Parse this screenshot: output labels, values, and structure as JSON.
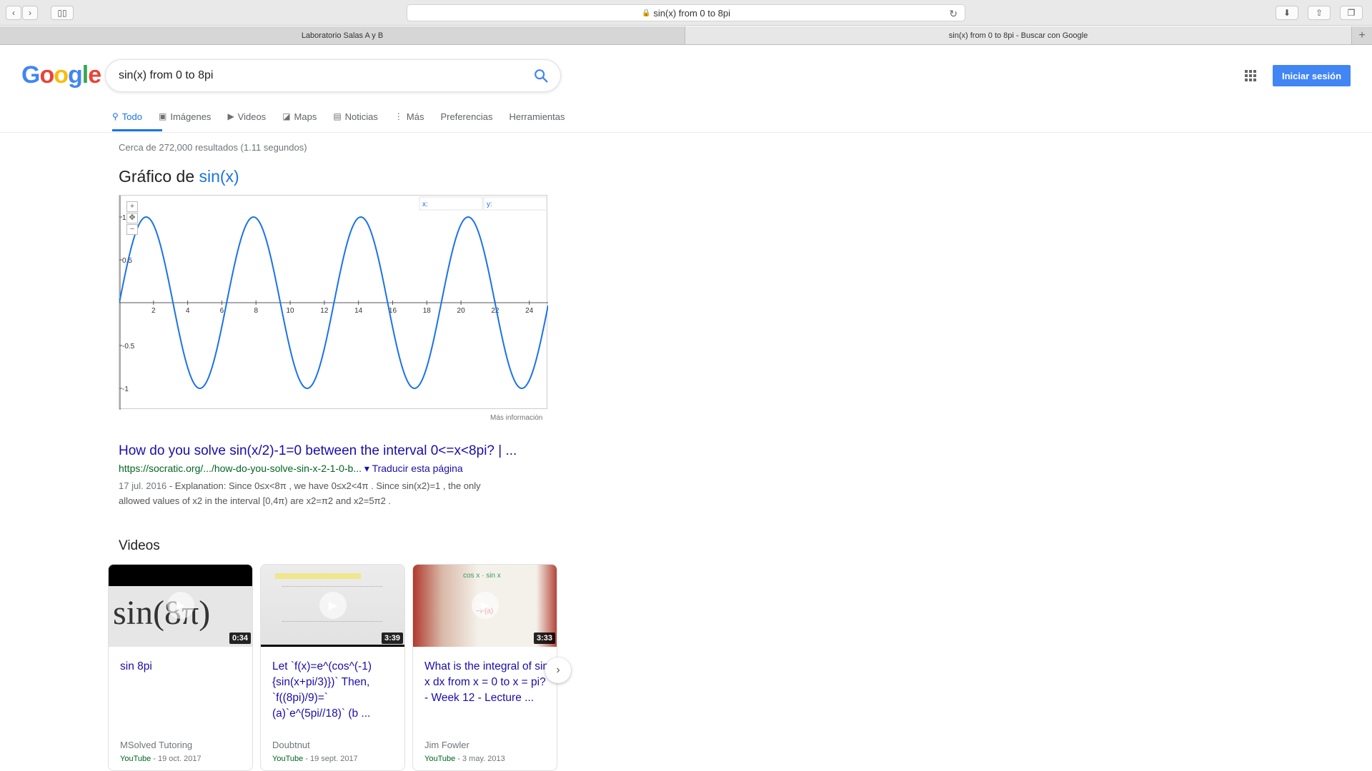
{
  "browser": {
    "url": "sin(x) from 0 to 8pi",
    "tabs": [
      {
        "label": "Laboratorio Salas A y B",
        "active": false
      },
      {
        "label": "sin(x) from 0 to 8pi - Buscar con Google",
        "active": true
      }
    ]
  },
  "header": {
    "logo_letters": [
      "G",
      "o",
      "o",
      "g",
      "l",
      "e"
    ],
    "query": "sin(x) from 0 to 8pi",
    "signin_label": "Iniciar sesión",
    "nav": [
      {
        "label": "Todo",
        "icon": "search-icon",
        "glyph": "🔍"
      },
      {
        "label": "Imágenes",
        "icon": "image-icon",
        "glyph": "▣"
      },
      {
        "label": "Videos",
        "icon": "play-icon",
        "glyph": "▶"
      },
      {
        "label": "Maps",
        "icon": "map-icon",
        "glyph": "◪"
      },
      {
        "label": "Noticias",
        "icon": "news-icon",
        "glyph": "▤"
      },
      {
        "label": "Más",
        "icon": "more-icon",
        "glyph": "⋮"
      },
      {
        "label": "Preferencias",
        "icon": "",
        "glyph": ""
      },
      {
        "label": "Herramientas",
        "icon": "",
        "glyph": ""
      }
    ]
  },
  "results": {
    "stats": "Cerca de 272,000 resultados (1.11 segundos)",
    "graph_prefix": "Gráfico de",
    "graph_function": "sin(x)",
    "more_info": "Más información",
    "first": {
      "title": "How do you solve sin(x/2)-1=0 between the interval 0<=x<8pi? | ...",
      "url": "https://socratic.org/.../how-do-you-solve-sin-x-2-1-0-b...",
      "translate": "▾ Traducir esta página",
      "date": "17 jul. 2016",
      "snippet_1": " - Explanation: Since 0≤x<8π , we have 0≤x2<4π . Since sin(x2)=1 , the only",
      "snippet_2": "allowed values of x2 in the interval [0,4π) are x2=π2 and x2=5π2 ."
    }
  },
  "chart_data": {
    "type": "line",
    "function": "sin(x)",
    "x_range": [
      0,
      25.1
    ],
    "ylim": [
      -1.25,
      1.25
    ],
    "x_ticks": [
      2,
      4,
      6,
      8,
      10,
      12,
      14,
      16,
      18,
      20,
      22,
      24
    ],
    "y_ticks": [
      1,
      0.5,
      -0.5,
      -1
    ],
    "x_readout_label": "x:",
    "y_readout_label": "y:",
    "series": [
      {
        "color": "#1a73e8",
        "values": "y = sin(x) for x in [0, 8π]"
      }
    ]
  },
  "videos": {
    "heading": "Videos",
    "items": [
      {
        "title": "sin 8pi",
        "channel": "MSolved Tutoring",
        "source": "YouTube",
        "date": " - 19 oct. 2017",
        "duration": "0:34",
        "thumb_text": "sin(8π)"
      },
      {
        "title": "Let `f(x)=e^(cos^(-1){sin(x+pi/3)})` Then, `f((8pi)/9)=` (a)`e^(5pi//18)` (b ...",
        "channel": "Doubtnut",
        "source": "YouTube",
        "date": " - 19 sept. 2017",
        "duration": "3:39",
        "thumb_text": ""
      },
      {
        "title": "What is the integral of sin x dx from x = 0 to x = pi? - Week 12 - Lecture ...",
        "channel": "Jim Fowler",
        "source": "YouTube",
        "date": " - 3 may. 2013",
        "duration": "3:33",
        "thumb_text": ""
      }
    ]
  }
}
